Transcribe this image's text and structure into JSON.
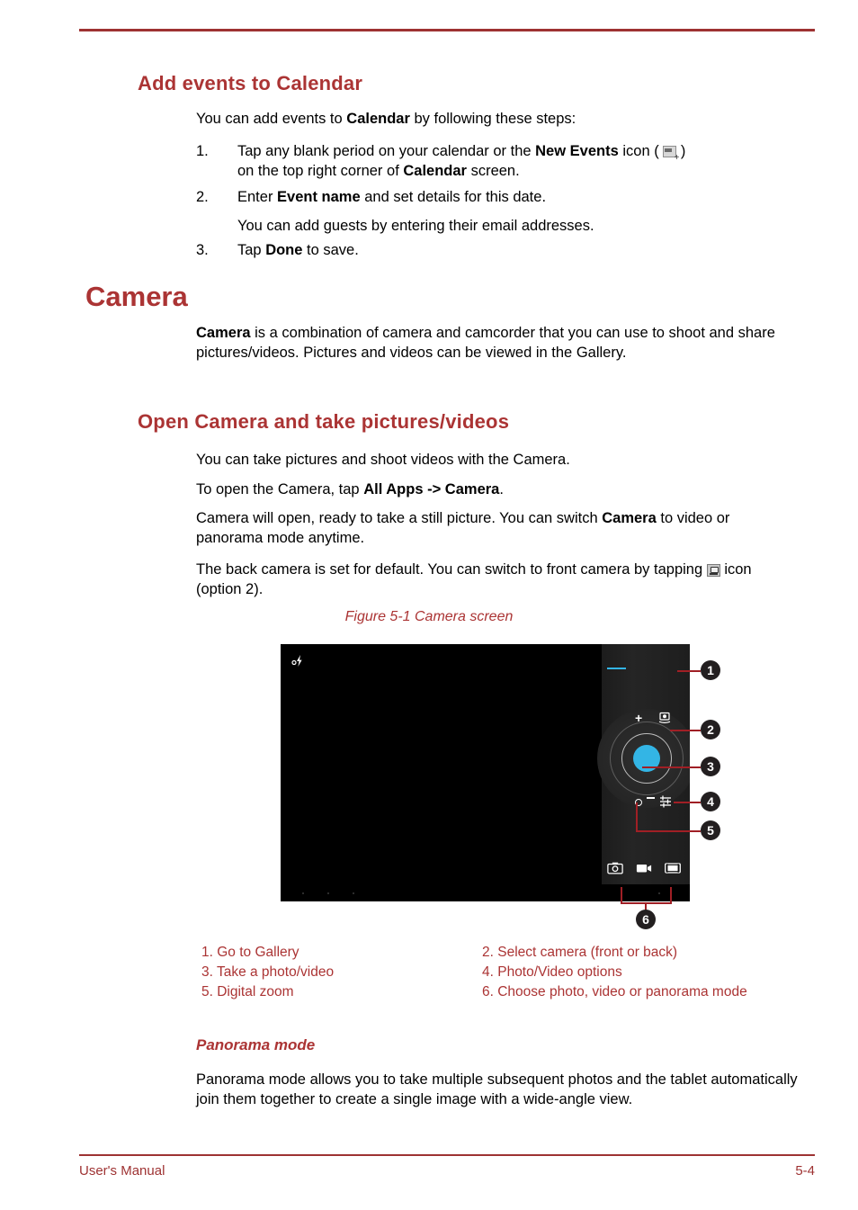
{
  "document": {
    "footer_left": "User's Manual",
    "footer_right": "5-4",
    "accent_color": "#ab3434",
    "rule_color": "#9e3232",
    "callout_color": "#a01f25"
  },
  "section_calendar": {
    "heading": "Add events to Calendar",
    "intro_pre": "You can add events to ",
    "intro_bold": "Calendar",
    "intro_post": " by following these steps:",
    "steps": [
      {
        "num": "1.",
        "part1": "Tap any blank period on your calendar or the ",
        "bold1": "New Events",
        "part2": " icon ( ",
        "icon": "new-events-icon",
        "part3": " )",
        "line2_pre": "on the top right corner of ",
        "line2_bold": "Calendar",
        "line2_post": " screen."
      },
      {
        "num": "2.",
        "part1": "Enter ",
        "bold1": "Event name",
        "part2": " and set details for this date."
      },
      {
        "num": "3.",
        "part1": "Tap ",
        "bold1": "Done",
        "part2": " to save."
      }
    ],
    "note": "You can add guests by entering their email addresses."
  },
  "section_camera": {
    "heading": "Camera",
    "intro_bold": "Camera",
    "intro_rest": " is a combination of camera and camcorder that you can use to shoot and share pictures/videos. Pictures and videos can be viewed in the Gallery.",
    "sub_heading": "Open Camera and take pictures/videos",
    "p1": "You can take pictures and shoot videos with the Camera.",
    "p2_pre": "To open the Camera, tap ",
    "p2_bold": "All Apps -> Camera",
    "p2_post": ".",
    "p3_pre": "Camera will open, ready to take a still picture. You can switch ",
    "p3_bold": "Camera",
    "p3_post": " to video or panorama mode anytime.",
    "p4_pre": "The back camera is set for default. You can switch to front camera by tapping ",
    "p4_icon": "switch-camera-icon",
    "p4_post": " icon (option 2)."
  },
  "figure": {
    "caption": "Figure 5-1 Camera screen",
    "screen": {
      "flash_icon": "flash-off-icon",
      "gallery_thumb": "gallery-thumbnail-box",
      "plus_label": "+",
      "minus_label": "−",
      "switch_camera_icon": "switch-camera-icon",
      "options_icon": "photo-video-options-icon",
      "shutter": "shutter-button",
      "zoom_handle": "digital-zoom-handle",
      "modes": [
        {
          "name": "photo-mode-icon",
          "selected": true
        },
        {
          "name": "video-mode-icon",
          "selected": false
        },
        {
          "name": "panorama-mode-icon",
          "selected": false
        }
      ]
    },
    "callouts": [
      "1",
      "2",
      "3",
      "4",
      "5",
      "6"
    ],
    "legend": [
      {
        "left": "1. Go to Gallery",
        "right": "2. Select camera (front or back)"
      },
      {
        "left": "3. Take a photo/video",
        "right": "4. Photo/Video options"
      },
      {
        "left": "5. Digital zoom",
        "right": "6. Choose photo, video or panorama mode"
      }
    ]
  },
  "section_panorama": {
    "heading": "Panorama mode",
    "body": "Panorama mode allows you to take multiple subsequent photos and the tablet automatically join them together to create a single image with a wide-angle view."
  }
}
